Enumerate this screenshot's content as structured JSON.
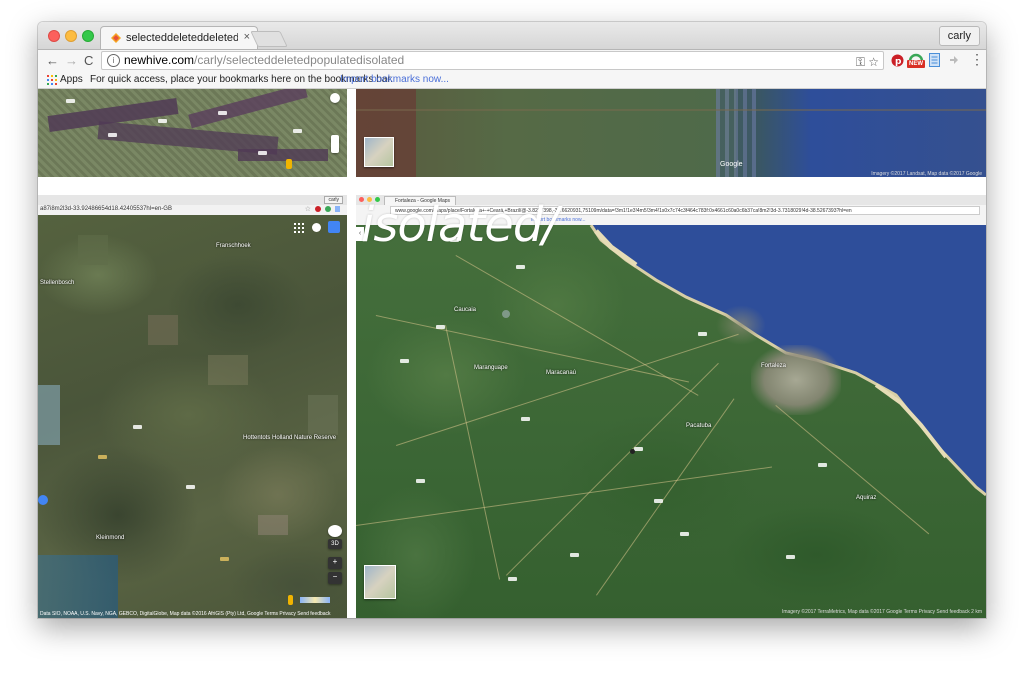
{
  "browser": {
    "tab_title": "selecteddeleteddeletedpopulatedisolated",
    "tab_close": "×",
    "profile": "carly",
    "url_host": "newhive.com",
    "url_path": "/carly/selecteddeletedpopulatedisolated",
    "info_glyph": "i",
    "nav": {
      "back": "←",
      "forward": "→",
      "reload": "C"
    },
    "icons": [
      "key-icon",
      "star-icon",
      "pinterest-icon",
      "new-badge-icon",
      "doc-icon",
      "extension-icon",
      "menu-icon"
    ],
    "new_badge": "NEW",
    "menu_glyph": "⋮",
    "star_glyph": "☆",
    "key_glyph": "⚿",
    "bookmarks": {
      "apps_label": "Apps",
      "message": "For quick access, place your bookmarks here on the bookmarks bar.",
      "import_link": "Import bookmarks now..."
    }
  },
  "page": {
    "overlay_text": "isolated/",
    "left_map": {
      "profile": "carly",
      "url": "a87i8m2l3d-33.92486654d18.42405537hl=en-GB",
      "zoom_in": "+",
      "zoom_out": "−",
      "attribution": "Data SIO, NOAA, U.S. Navy, NGA, GEBCO, DigitalGlobe, Map data ©2016 AfriGIS (Pty) Ltd, Google   Terms   Privacy   Send feedback",
      "places": [
        "Franschhoek",
        "Stellenbosch",
        "Hottentots Holland Nature Reserve",
        "Kleinmond"
      ]
    },
    "right_map": {
      "tab_title": "Fortaleza - Google Maps",
      "url_text": "Ceará,+Brazil/@-3.8227398,-38.6620931,75109m/data=!3m1!1e3!4m5!3m4!1s0x7c74c3f464c783f:0x4661c60a0c6b37ca!8m2!3d-3.7318029!4d-38.5267393?hl=en",
      "url_prefix": "www.google.com/maps/place/Fortaleza+-+",
      "import_text": "Import bookmarks now...",
      "places": [
        "Fortaleza",
        "Caucaia",
        "Maracanaú",
        "Pacatuba",
        "Aquiraz",
        "Maranguape"
      ],
      "attribution": "Imagery ©2017 TerraMetrics, Map data ©2017 Google   Terms   Privacy   Send feedback   2 km"
    },
    "top_right_map": {
      "attribution": "Imagery ©2017 Landsat, Map data ©2017 Google",
      "logo": "Google"
    }
  },
  "colors": {
    "ocean": "#2e4e9a",
    "land": "#3f6a37",
    "mountain": "#4d5a3c",
    "link": "#4a6fd8"
  }
}
